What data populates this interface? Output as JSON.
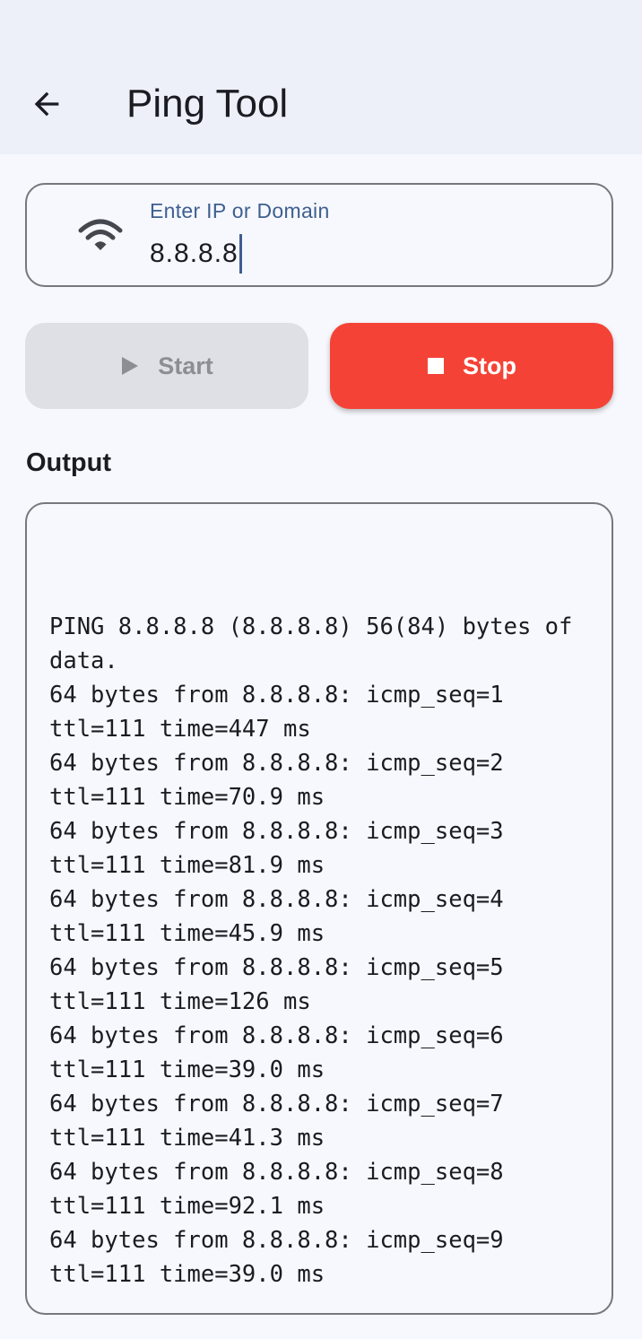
{
  "app_bar": {
    "title": "Ping Tool",
    "back_icon": "arrow-left-icon"
  },
  "target_input": {
    "label": "Enter IP or Domain",
    "value": "8.8.8.8",
    "icon": "wifi-icon"
  },
  "buttons": {
    "start_label": "Start",
    "start_icon": "play-icon",
    "stop_label": "Stop",
    "stop_icon": "stop-icon"
  },
  "output": {
    "heading": "Output",
    "lines": [
      "PING 8.8.8.8 (8.8.8.8) 56(84) bytes of data.",
      "64 bytes from 8.8.8.8: icmp_seq=1 ttl=111 time=447 ms",
      "64 bytes from 8.8.8.8: icmp_seq=2 ttl=111 time=70.9 ms",
      "64 bytes from 8.8.8.8: icmp_seq=3 ttl=111 time=81.9 ms",
      "64 bytes from 8.8.8.8: icmp_seq=4 ttl=111 time=45.9 ms",
      "64 bytes from 8.8.8.8: icmp_seq=5 ttl=111 time=126 ms",
      "64 bytes from 8.8.8.8: icmp_seq=6 ttl=111 time=39.0 ms",
      "64 bytes from 8.8.8.8: icmp_seq=7 ttl=111 time=41.3 ms",
      "64 bytes from 8.8.8.8: icmp_seq=8 ttl=111 time=92.1 ms",
      "64 bytes from 8.8.8.8: icmp_seq=9 ttl=111 time=39.0 ms"
    ]
  },
  "colors": {
    "app_bar_bg": "#edf0f8",
    "page_bg": "#f7f8fd",
    "accent": "#3e5f90",
    "stop_red": "#f44336",
    "disabled_bg": "#dfe0e5"
  }
}
